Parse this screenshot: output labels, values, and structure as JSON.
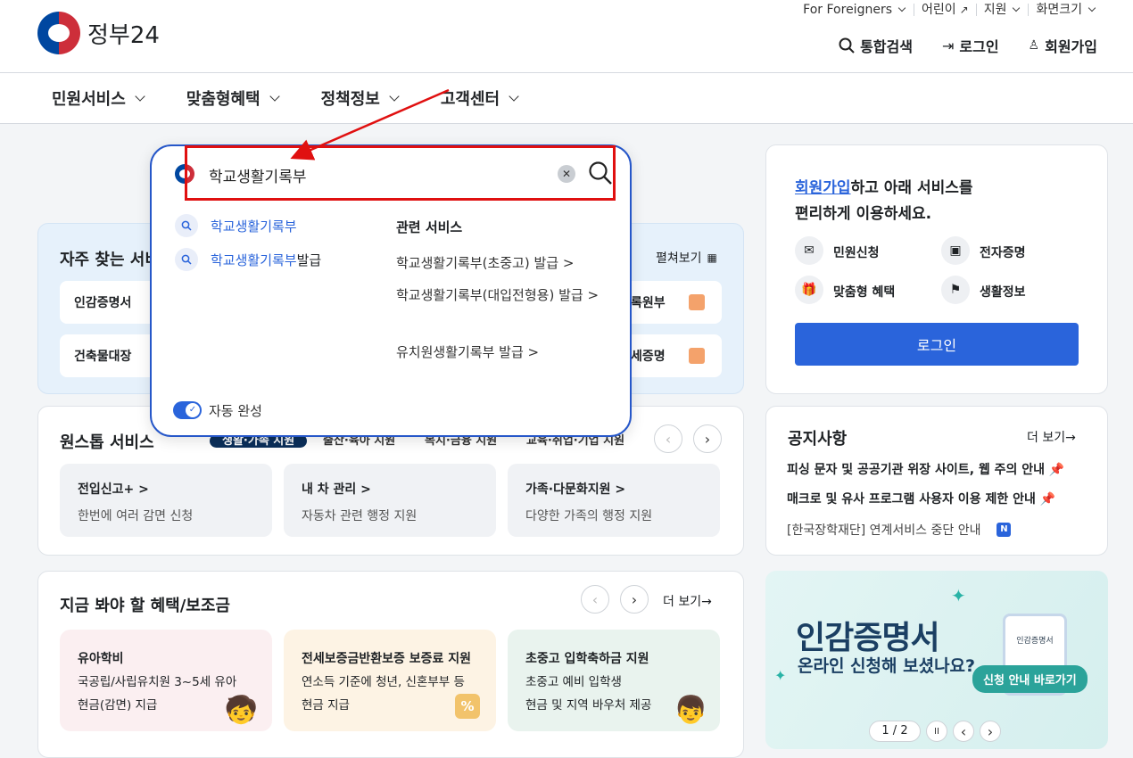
{
  "header": {
    "logo_text": "정부24",
    "util": [
      "For Foreigners",
      "어린이",
      "지원",
      "화면크기"
    ],
    "main": [
      "통합검색",
      "로그인",
      "회원가입"
    ]
  },
  "nav": {
    "items": [
      "민원서비스",
      "맞춤형혜택",
      "정책정보",
      "고객센터"
    ]
  },
  "search": {
    "query": "학교생활기록부",
    "suggestions": [
      {
        "match": "학교생활기록부",
        "rest": ""
      },
      {
        "match": "학교생활기록부",
        "rest": "발급"
      }
    ],
    "related_title": "관련 서비스",
    "related": [
      "학교생활기록부(초중고) 발급 >",
      "학교생활기록부(대입전형용) 발급 >",
      "유치원생활기록부 발급 >"
    ],
    "autocomplete_label": "자동 완성"
  },
  "frequent": {
    "title": "자주 찾는 서비",
    "expand": "펼쳐보기",
    "items": [
      "인감증명서",
      "건축물대장",
      "록원부",
      "세증명"
    ]
  },
  "onestop": {
    "title": "원스톱 서비스",
    "tabs": [
      "생활·가족 지원",
      "출산·육아 지원",
      "복지·금융 지원",
      "교육·취업·기업 지원"
    ],
    "cards": [
      {
        "title": "전입신고+ >",
        "desc": "한번에 여러 감면 신청"
      },
      {
        "title": "내 차 관리 >",
        "desc": "자동차 관련 행정 지원"
      },
      {
        "title": "가족·다문화지원 >",
        "desc": "다양한 가족의 행정 지원"
      }
    ]
  },
  "benefits": {
    "title": "지금 봐야 할 혜택/보조금",
    "more": "더 보기→",
    "cards": [
      {
        "title": "유아학비",
        "l1": "국공립/사립유치원 3~5세 유아",
        "l2": "현금(감면) 지급"
      },
      {
        "title": "전세보증금반환보증 보증료 지원",
        "l1": "연소득 기준에 청년, 신혼부부 등",
        "l2": "현금 지급"
      },
      {
        "title": "초중고 입학축하금 지원",
        "l1": "초중고 예비 입학생",
        "l2": "현금 및 지역 바우처 제공"
      }
    ]
  },
  "signup": {
    "link": "회원가입",
    "line1_rest": "하고 아래 서비스를",
    "line2": "편리하게 이용하세요.",
    "services": [
      "민원신청",
      "전자증명",
      "맞춤형 혜택",
      "생활정보"
    ],
    "login_button": "로그인"
  },
  "notice": {
    "title": "공지사항",
    "more": "더 보기→",
    "items": [
      "피싱 문자 및 공공기관 위장 사이트, 웹 주의 안내",
      "매크로 및 유사 프로그램 사용자 이용 제한 안내",
      "[한국장학재단] 연계서비스 중단 안내"
    ],
    "new_badge": "N"
  },
  "banner": {
    "title": "인감증명서",
    "subtitle": "온라인 신청해 보셨나요?",
    "button": "신청 안내 바로가기",
    "doc_label": "인감증명서",
    "pager": "1 / 2"
  },
  "colors": {
    "primary": "#2a64db",
    "navy": "#0b2f5a",
    "annotation": "#e01010"
  }
}
